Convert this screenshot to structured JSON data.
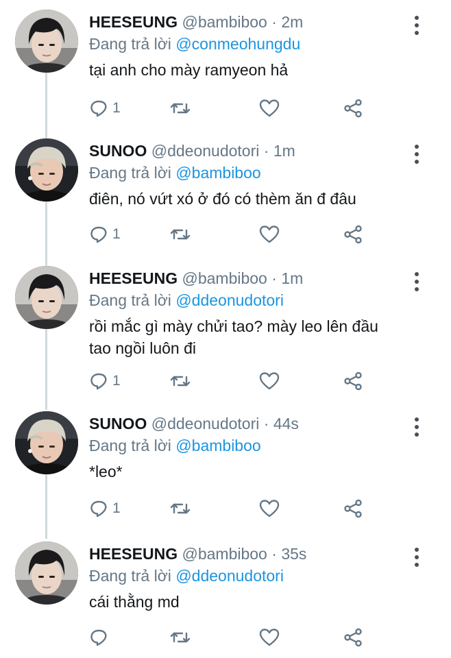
{
  "tweets": [
    {
      "name": "HEESEUNG",
      "handle": "@bambiboo",
      "time": "2m",
      "replying_label": "Đang trả lời",
      "replying_to": "@conmeohungdu",
      "text_lines": [
        "tại anh cho mày ramyeon hả"
      ],
      "reply_count": "1",
      "avatar": "dark"
    },
    {
      "name": "SUNOO",
      "handle": "@ddeonudotori",
      "time": "1m",
      "replying_label": "Đang trả lời",
      "replying_to": "@bambiboo",
      "text_lines": [
        "điên, nó vứt xó ở đó có thèm ăn đ đâu"
      ],
      "reply_count": "1",
      "avatar": "blonde"
    },
    {
      "name": "HEESEUNG",
      "handle": "@bambiboo",
      "time": "1m",
      "replying_label": "Đang trả lời",
      "replying_to": "@ddeonudotori",
      "text_lines": [
        "rồi mắc gì mày chửi tao? mày leo lên đầu",
        "tao ngồi luôn đi"
      ],
      "reply_count": "1",
      "avatar": "dark"
    },
    {
      "name": "SUNOO",
      "handle": "@ddeonudotori",
      "time": "44s",
      "replying_label": "Đang trả lời",
      "replying_to": "@bambiboo",
      "text_lines": [
        "*leo*"
      ],
      "reply_count": "1",
      "avatar": "blonde"
    },
    {
      "name": "HEESEUNG",
      "handle": "@bambiboo",
      "time": "35s",
      "replying_label": "Đang trả lời",
      "replying_to": "@ddeonudotori",
      "text_lines": [
        "cái thằng md"
      ],
      "reply_count": "",
      "avatar": "dark"
    }
  ],
  "separator": "·",
  "colors": {
    "accent": "#1b95e0",
    "muted": "#657786",
    "text": "#14171a",
    "thread_line": "#cfd9de"
  },
  "icons": {
    "reply": "reply-icon",
    "retweet": "retweet-icon",
    "like": "heart-icon",
    "share": "share-icon",
    "more": "more-vertical-icon"
  }
}
